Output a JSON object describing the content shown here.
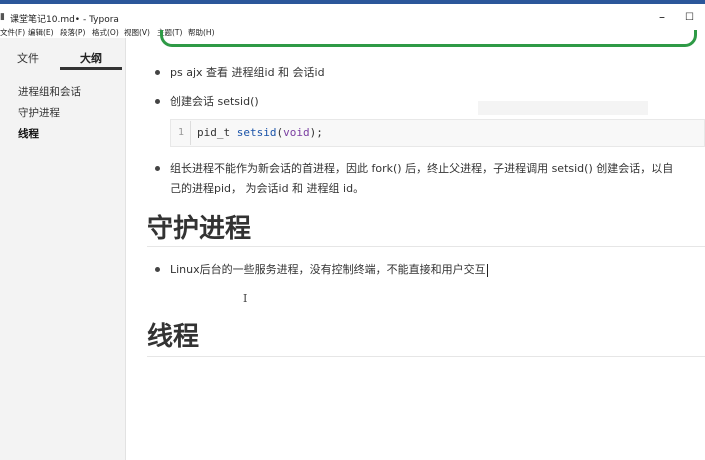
{
  "window": {
    "title": "课堂笔记10.md• - Typora",
    "minimize": "–",
    "maximize": "☐"
  },
  "menu": [
    "文件(F)",
    "编辑(E)",
    "段落(P)",
    "格式(O)",
    "视图(V)",
    "主题(T)",
    "帮助(H)"
  ],
  "sidebar": {
    "tabs": {
      "files": "文件",
      "outline": "大纲"
    },
    "outline_items": [
      "进程组和会话",
      "守护进程",
      "线程"
    ],
    "active_index": 2
  },
  "content": {
    "bullets_top": [
      "ps ajx 查看 进程组id 和 会话id",
      "创建会话 setsid()"
    ],
    "code": {
      "line_number": "1",
      "type": "pid_t",
      "fn": "setsid",
      "args": "void",
      "tail": ");"
    },
    "bullet_long_line1": "组长进程不能作为新会话的首进程，因此 fork() 后，终止父进程，子进程调用 setsid() 创建会话，以自",
    "bullet_long_line2": "己的进程pid， 为会话id 和 进程组 id。",
    "heading_daemon": "守护进程",
    "bullet_daemon": "Linux后台的一些服务进程，没有控制终端，不能直接和用户交互",
    "heading_thread": "线程"
  }
}
